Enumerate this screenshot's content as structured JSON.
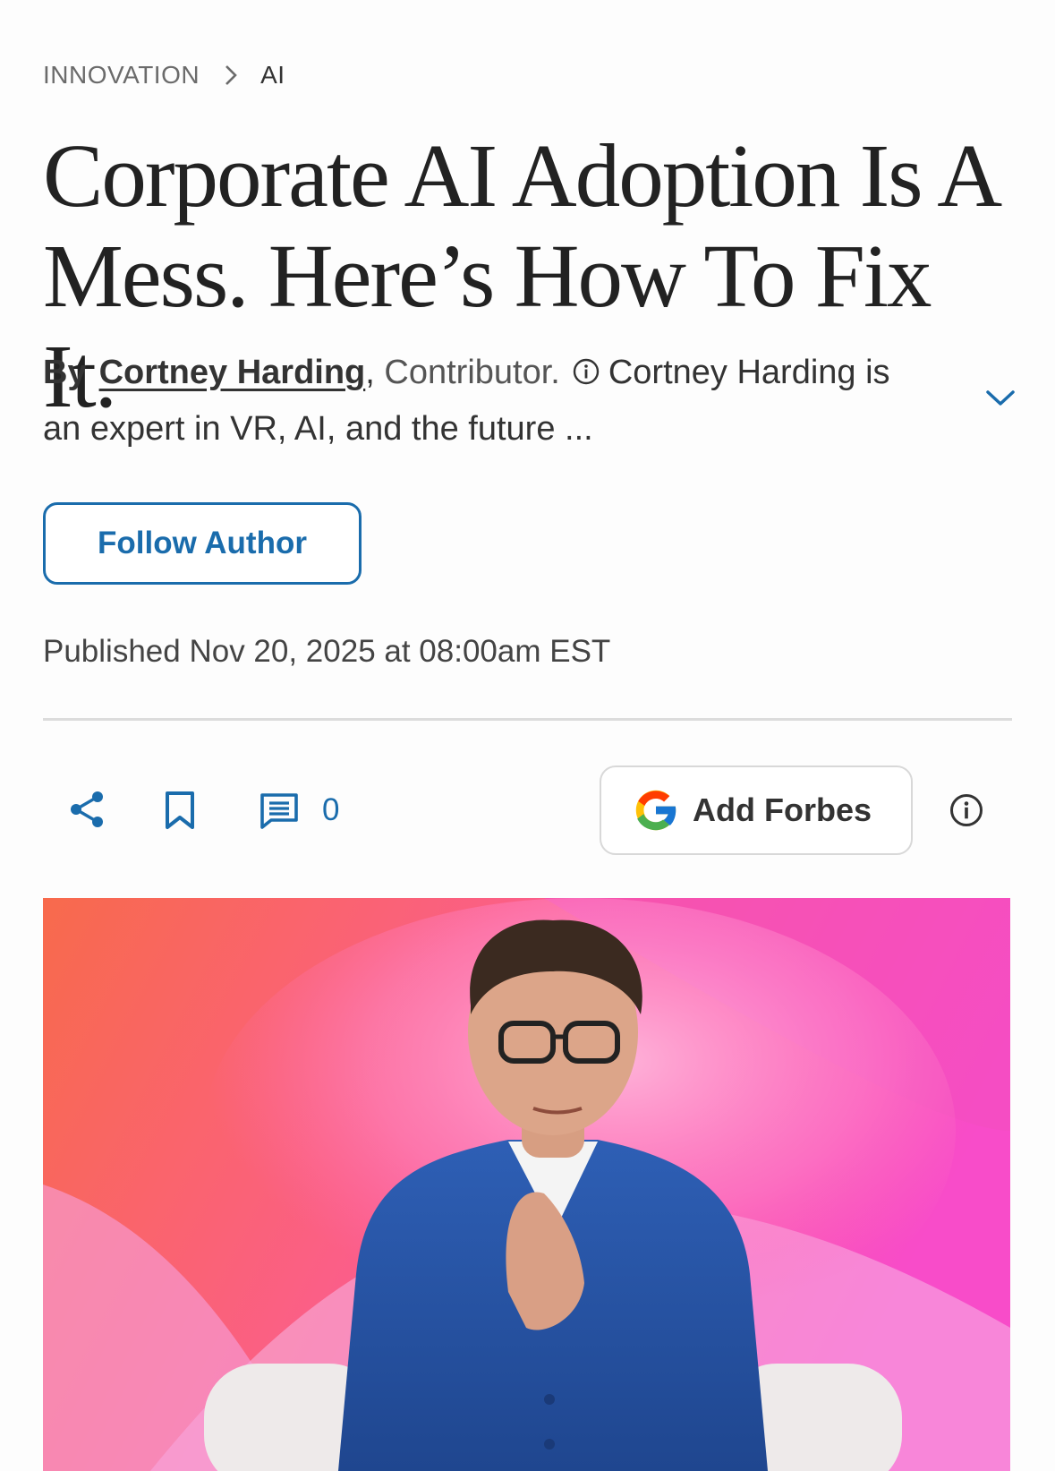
{
  "breadcrumb": {
    "section": "INNOVATION",
    "current": "AI"
  },
  "article": {
    "headline": "Corporate AI Adoption Is A Mess. Here’s How To Fix It.",
    "byline": {
      "by_label": "By",
      "author_name": "Cortney Harding",
      "author_suffix": ",",
      "role": "Contributor.",
      "bio_preview": "Cortney Harding is an expert in VR, AI, and the future ..."
    },
    "follow_label": "Follow Author",
    "published": "Published Nov 20, 2025 at 08:00am EST"
  },
  "actions": {
    "share_icon": "share-icon",
    "bookmark_icon": "bookmark-icon",
    "comment_icon": "comment-icon",
    "comment_count": "0",
    "add_forbes_label": "Add Forbes",
    "google_icon": "google-g-icon",
    "info_icon": "info-icon"
  },
  "colors": {
    "accent": "#1a6cac",
    "text": "#333333",
    "divider": "#dcdcdc",
    "background": "#fdfdfd"
  }
}
